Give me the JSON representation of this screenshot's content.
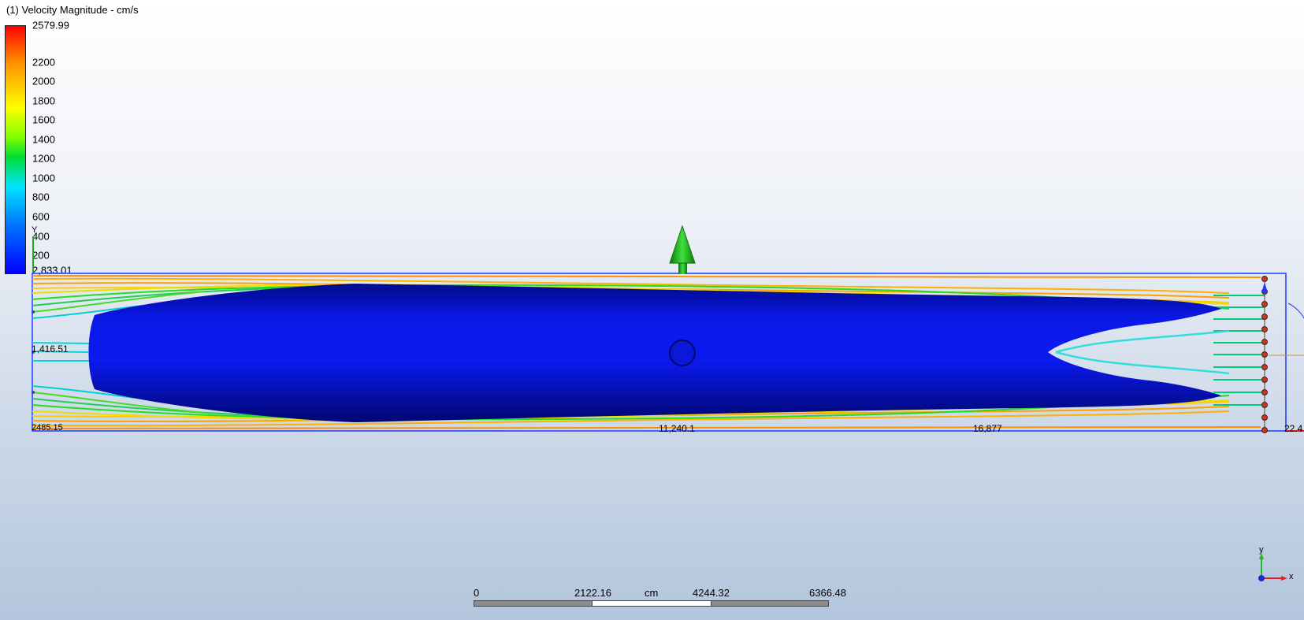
{
  "legend": {
    "title": "(1) Velocity Magnitude - cm/s",
    "max_label": "2579.99",
    "ticks": [
      "2200",
      "2000",
      "1800",
      "1600",
      "1400",
      "1200",
      "1000",
      "800",
      "600",
      "400",
      "200"
    ],
    "min_label": "2,833.01"
  },
  "viewport": {
    "axis_y_label": "Y",
    "axis_values": {
      "left_mid": "1,416.51",
      "bottom_left": "2485.15",
      "bottom_center": "11,240.1",
      "bottom_right_mid": "16,877",
      "bottom_right": "22.4"
    }
  },
  "triad": {
    "x_label": "x",
    "y_label": "y"
  },
  "scale_bar": {
    "labels": [
      "0",
      "2122.16",
      "cm",
      "4244.32",
      "6366.48"
    ]
  },
  "colors": {
    "body_fill": "#0a14e6",
    "streamline_fast": "#ffb000",
    "streamline_mid": "#22dd22",
    "streamline_slow": "#00e0e0",
    "arrow": "#1fbf1f"
  }
}
